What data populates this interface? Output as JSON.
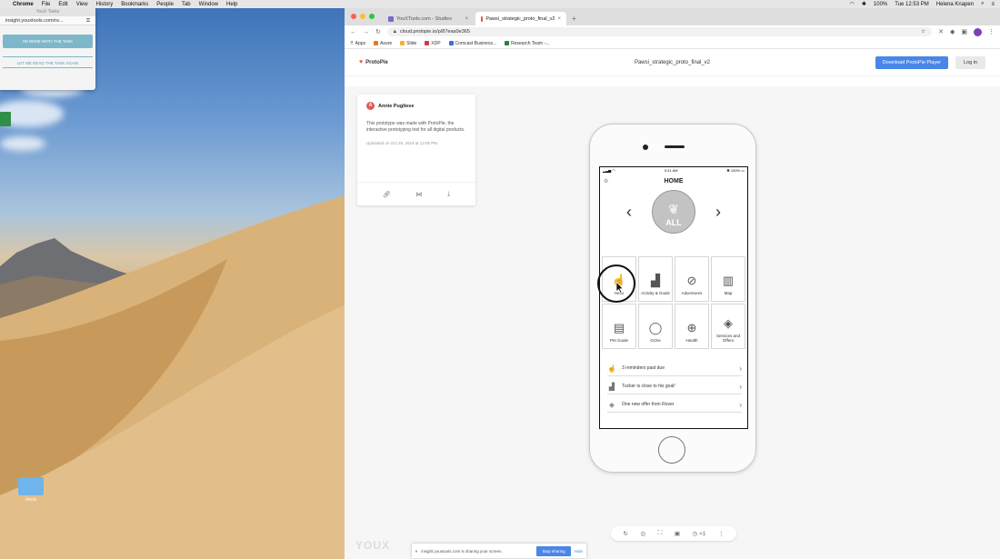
{
  "menubar": {
    "app": "Chrome",
    "items": [
      "File",
      "Edit",
      "View",
      "History",
      "Bookmarks",
      "People",
      "Tab",
      "Window",
      "Help"
    ],
    "battery": "100%",
    "clock": "Tue 12:53 PM",
    "user": "Helena Knapen"
  },
  "task_window": {
    "title": "YouX Tasks",
    "url": "insight.youxtools.com/re...",
    "done_label": "I'M DONE WITH THE TASK",
    "reread_label": "LET ME READ THE TASK AGAIN"
  },
  "desktop": {
    "folder_label": "mock"
  },
  "browser": {
    "tabs": [
      {
        "label": "YouXTools.com - Studies",
        "active": false
      },
      {
        "label": "Pawsi_strategic_proto_final_v2",
        "active": true
      }
    ],
    "url": "cloud.protopie.io/p/87eaa0e365",
    "bookmarks": [
      "Apps",
      "Axure",
      "Slide",
      "XDP",
      "Comcast Business...",
      "Research Team -..."
    ]
  },
  "protopie": {
    "logo": "ProtoPie",
    "title": "Pawsi_strategic_proto_final_v2",
    "download_label": "Download ProtoPie Player",
    "login_label": "Log in",
    "card": {
      "avatar": "A",
      "author": "Annie Pugliese",
      "description": "This prototype was made with ProtoPie, the interactive prototyping tool for all digital products.",
      "date": "Uploaded on Oct 29, 2019 at 12:05 PM"
    }
  },
  "app": {
    "status_time": "9:41 AM",
    "status_battery": "100%",
    "title": "HOME",
    "pet_label": "ALL",
    "tiles": [
      {
        "label": "Hello",
        "icon": "hand-icon"
      },
      {
        "label": "Activity & Goals",
        "icon": "steps-chart-icon"
      },
      {
        "label": "Adventures",
        "icon": "compass-icon"
      },
      {
        "label": "Map",
        "icon": "map-icon"
      },
      {
        "label": "Pet Guide",
        "icon": "book-icon"
      },
      {
        "label": "Ozzie",
        "icon": "collar-icon"
      },
      {
        "label": "Health",
        "icon": "paw-cross-icon"
      },
      {
        "label": "Services and Offers",
        "icon": "tag-icon"
      }
    ],
    "notifications": [
      {
        "text": "3 reminders past due",
        "icon": "hand-icon"
      },
      {
        "text": "Tucker is close to his goal!",
        "icon": "steps-chart-icon"
      },
      {
        "text": "One new offer from Rover",
        "icon": "tag-icon"
      }
    ]
  },
  "toolbar": {
    "speed": "×1"
  },
  "share_bar": {
    "text": "insight.youxtools.com is sharing your screen.",
    "stop_label": "Stop sharing",
    "hide_label": "Hide"
  },
  "watermark": "YOUX"
}
